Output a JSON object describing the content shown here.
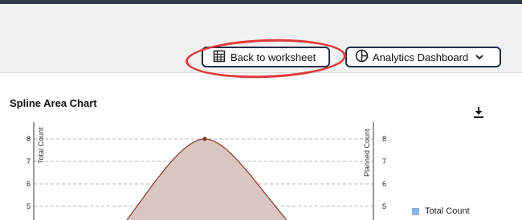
{
  "toolbar": {
    "back_label": "Back to worksheet",
    "dashboard_label": "Analytics Dashboard",
    "back_icon": "spreadsheet-icon",
    "dashboard_icon": "pie-chart-icon",
    "dropdown_icon": "chevron-down-icon",
    "highlight_color": "#e0393a",
    "border_color": "#1f2d4a"
  },
  "chart": {
    "download_icon": "download-icon",
    "legend": [
      {
        "label": "Total Count",
        "color": "#8fb4e3"
      }
    ]
  },
  "chart_data": {
    "type": "area",
    "title": "Spline Area Chart",
    "ylabel": "Total Count",
    "y2label": "Planned Count",
    "yticks": [
      "8",
      "7",
      "6",
      "5"
    ],
    "y2ticks": [
      "8",
      "7",
      "6",
      "5"
    ],
    "ylim_visible": [
      4.5,
      8.5
    ],
    "grid": true,
    "series": [
      {
        "values": [
          8
        ],
        "color": "#8b3a2a",
        "fill": "#d9c6c0",
        "peak": 8
      }
    ],
    "legend_position": "right"
  }
}
